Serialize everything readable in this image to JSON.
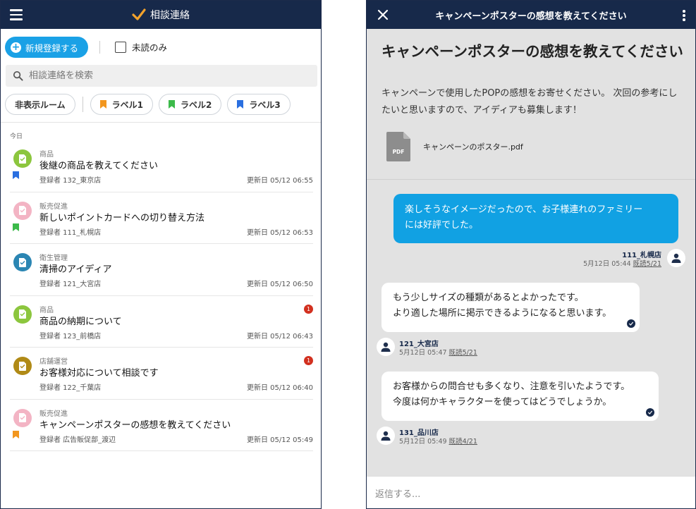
{
  "left": {
    "title": "相談連絡",
    "new_button": "新規登録する",
    "unread_only": "未読のみ",
    "search_placeholder": "相談連絡を検索",
    "chips": {
      "hidden_rooms": "非表示ルーム",
      "labels": [
        {
          "text": "ラベル1",
          "color": "#f2961e"
        },
        {
          "text": "ラベル2",
          "color": "#3cba4a"
        },
        {
          "text": "ラベル3",
          "color": "#2a6fe0"
        }
      ]
    },
    "day_label": "今日",
    "items": [
      {
        "category": "商品",
        "title": "後継の商品を教えてください",
        "author": "登録者 132_東京店",
        "updated": "更新日 05/12 06:55",
        "avatar_color": "#8cc63e",
        "flag_color": "#2a6fe0",
        "badge": ""
      },
      {
        "category": "販売促進",
        "title": "新しいポイントカードへの切り替え方法",
        "author": "登録者 111_札幌店",
        "updated": "更新日 05/12 06:53",
        "avatar_color": "#f3b4c4",
        "flag_color": "#3cba4a",
        "badge": ""
      },
      {
        "category": "衛生管理",
        "title": "清掃のアイディア",
        "author": "登録者 121_大宮店",
        "updated": "更新日 05/12 06:50",
        "avatar_color": "#2b86b3",
        "flag_color": "",
        "badge": ""
      },
      {
        "category": "商品",
        "title": "商品の納期について",
        "author": "登録者 123_前橋店",
        "updated": "更新日 05/12 06:43",
        "avatar_color": "#8cc63e",
        "flag_color": "",
        "badge": "1"
      },
      {
        "category": "店舗運営",
        "title": "お客様対応について相談です",
        "author": "登録者 122_千葉店",
        "updated": "更新日 05/12 06:40",
        "avatar_color": "#b08a16",
        "flag_color": "",
        "badge": "1"
      },
      {
        "category": "販売促進",
        "title": "キャンペーンポスターの感想を教えてください",
        "author": "登録者 広告販促部_渡辺",
        "updated": "更新日 05/12 05:49",
        "avatar_color": "#f3b4c4",
        "flag_color": "#f2961e",
        "badge": ""
      }
    ]
  },
  "right": {
    "header_title": "キャンペーンポスターの感想を教えてください",
    "post_title": "キャンペーンポスターの感想を教えてください",
    "post_body": "キャンペーンで使用したPOPの感想をお寄せください。 次回の参考にしたいと思いますので、アイディアも募集します！",
    "attachment": "キャンペーンのポスター.pdf",
    "attachment_type": "PDF",
    "messages": [
      {
        "line1": "楽しそうなイメージだったので、お子様連れのファミリー",
        "line2": "には好評でした。",
        "sender": "111_札幌店",
        "time": "5月12日 05:44",
        "read": "既読5/21"
      },
      {
        "line1": "もう少しサイズの種類があるとよかったです。",
        "line2": "より適した場所に掲示できるようになると思います。",
        "sender": "121_大宮店",
        "time": "5月12日 05:47",
        "read": "既読5/21"
      },
      {
        "line1": "お客様からの問合せも多くなり、注意を引いたようです。",
        "line2": "今度は何かキャラクターを使ってはどうでしょうか。",
        "sender": "131_品川店",
        "time": "5月12日 05:49",
        "read": "既読4/21"
      }
    ],
    "reply_placeholder": "返信する..."
  }
}
